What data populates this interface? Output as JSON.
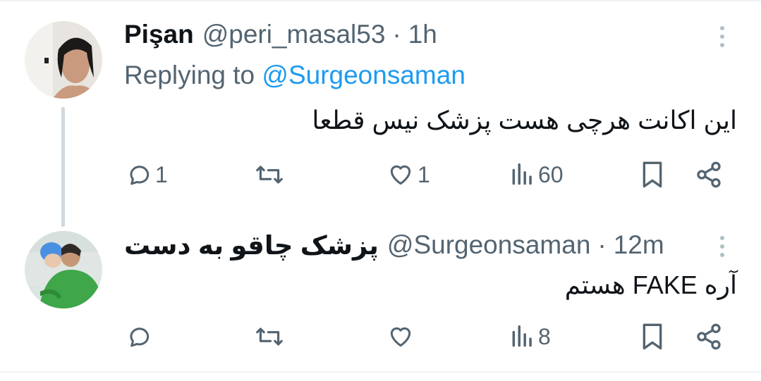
{
  "tweets": [
    {
      "author_name": "Pişan",
      "handle": "@peri_masal53",
      "separator": "·",
      "time": "1h",
      "replying_label": "Replying to",
      "replying_to": "@Surgeonsaman",
      "text": "این اکانت هرچی هست پزشک نیس قطعا",
      "actions": {
        "reply": "1",
        "retweet": "",
        "like": "1",
        "views": "60"
      },
      "avatar_icon": "profile-photo",
      "colors": {
        "avatar_bg": "#e8e4df"
      }
    },
    {
      "author_name": "پزشک چاقو به دست",
      "handle": "@Surgeonsaman",
      "separator": "·",
      "time": "12m",
      "text": "آره FAKE هستم",
      "actions": {
        "reply": "",
        "retweet": "",
        "like": "",
        "views": "8"
      },
      "avatar_icon": "surgeon-photo",
      "colors": {
        "avatar_bg": "#3fa64a"
      }
    }
  ],
  "colors": {
    "link": "#1d9bf0",
    "secondary_text": "#536471",
    "divider": "#eff3f4",
    "thread_line": "#cfd9de"
  }
}
